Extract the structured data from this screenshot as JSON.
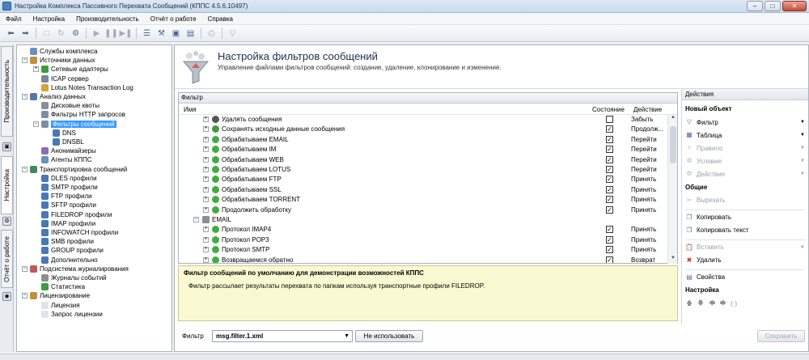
{
  "window": {
    "title": "Настройка Комплекса Пассивного Перехвата Сообщений (КППС 4.5.6.10497)",
    "minimize": "–",
    "maximize": "□",
    "close": "✕"
  },
  "menu": [
    "Файл",
    "Настройка",
    "Производительность",
    "Отчёт о работе",
    "Справка"
  ],
  "sidetabs": {
    "perf": "Производительность",
    "settings": "Настройка",
    "report": "Отчёт о работе"
  },
  "tree": [
    {
      "label": "Службы комплекса",
      "level": 0,
      "toggle": "",
      "icon": "#6b8fc0"
    },
    {
      "label": "Источники данных",
      "level": 0,
      "toggle": "−",
      "icon": "#c0913a"
    },
    {
      "label": "Сетевые адаптеры",
      "level": 1,
      "toggle": "+",
      "icon": "#3f9a3f"
    },
    {
      "label": "ICAP сервер",
      "level": 1,
      "toggle": "",
      "icon": "#7a8795"
    },
    {
      "label": "Lotus Notes Transaction Log",
      "level": 1,
      "toggle": "",
      "icon": "#d2a43a"
    },
    {
      "label": "Анализ данных",
      "level": 0,
      "toggle": "−",
      "icon": "#5577aa"
    },
    {
      "label": "Дисковые квоты",
      "level": 1,
      "toggle": "",
      "icon": "#8a8f96"
    },
    {
      "label": "Фильтры HTTP запросов",
      "level": 1,
      "toggle": "",
      "icon": "#7d8ea3"
    },
    {
      "label": "Фильтры сообщений",
      "level": 1,
      "toggle": "−",
      "icon": "#7d8ea3",
      "selected": true
    },
    {
      "label": "DNS",
      "level": 2,
      "toggle": "",
      "icon": "#4a78b5"
    },
    {
      "label": "DNSBL",
      "level": 2,
      "toggle": "",
      "icon": "#4a78b5"
    },
    {
      "label": "Анонимайзеры",
      "level": 1,
      "toggle": "",
      "icon": "#8a6fb0"
    },
    {
      "label": "Агенты КППС",
      "level": 1,
      "toggle": "",
      "icon": "#6b8fc0"
    },
    {
      "label": "Транспортировка сообщений",
      "level": 0,
      "toggle": "−",
      "icon": "#3f8a5a"
    },
    {
      "label": "DLES профили",
      "level": 1,
      "toggle": "",
      "icon": "#4a78b5"
    },
    {
      "label": "SMTP профили",
      "level": 1,
      "toggle": "",
      "icon": "#4a78b5"
    },
    {
      "label": "FTP профили",
      "level": 1,
      "toggle": "",
      "icon": "#4a78b5"
    },
    {
      "label": "SFTP профили",
      "level": 1,
      "toggle": "",
      "icon": "#4a78b5"
    },
    {
      "label": "FILEDROP профили",
      "level": 1,
      "toggle": "",
      "icon": "#4a78b5"
    },
    {
      "label": "IMAP профили",
      "level": 1,
      "toggle": "",
      "icon": "#4a78b5"
    },
    {
      "label": "INFOWATCH профили",
      "level": 1,
      "toggle": "",
      "icon": "#4a78b5"
    },
    {
      "label": "SMB профили",
      "level": 1,
      "toggle": "",
      "icon": "#4a78b5"
    },
    {
      "label": "GROUP профили",
      "level": 1,
      "toggle": "",
      "icon": "#4a78b5"
    },
    {
      "label": "Дополнительно",
      "level": 1,
      "toggle": "",
      "icon": "#4a78b5"
    },
    {
      "label": "Подсистема журналирования",
      "level": 0,
      "toggle": "−",
      "icon": "#c05a5a"
    },
    {
      "label": "Журналы событий",
      "level": 1,
      "toggle": "",
      "icon": "#8a8f96"
    },
    {
      "label": "Статистика",
      "level": 1,
      "toggle": "",
      "icon": "#3f9a3f"
    },
    {
      "label": "Лицензирование",
      "level": 0,
      "toggle": "−",
      "icon": "#c0913a"
    },
    {
      "label": "Лицензия",
      "level": 1,
      "toggle": "",
      "icon": "#dfe4ea"
    },
    {
      "label": "Запрос лицензии",
      "level": 1,
      "toggle": "",
      "icon": "#dfe4ea"
    }
  ],
  "header": {
    "title": "Настройка фильтров сообщений",
    "subtitle": "Управление файлами фильтров сообщений: создание, удаление, клонирование и изменение."
  },
  "filter_panel": {
    "title": "Фильтр",
    "col_name": "Имя",
    "col_state": "Состояние",
    "col_action": "Действие",
    "rows": [
      {
        "name": "Удалять сообщения",
        "level": 1,
        "icon": "#555555",
        "checked": false,
        "action": "Забыть"
      },
      {
        "name": "Сохранять исходные данные сообщения",
        "level": 1,
        "icon": "#3f9a3f",
        "checked": true,
        "action": "Продолж..."
      },
      {
        "name": "Обрабатываем EMAIL",
        "level": 1,
        "icon": "#3fae3f",
        "checked": true,
        "action": "Перейти"
      },
      {
        "name": "Обрабатываем IM",
        "level": 1,
        "icon": "#3fae3f",
        "checked": true,
        "action": "Перейти"
      },
      {
        "name": "Обрабатываем WEB",
        "level": 1,
        "icon": "#3fae3f",
        "checked": true,
        "action": "Перейти"
      },
      {
        "name": "Обрабатываем LOTUS",
        "level": 1,
        "icon": "#3fae3f",
        "checked": true,
        "action": "Перейти"
      },
      {
        "name": "Обрабатываем FTP",
        "level": 1,
        "icon": "#3fae3f",
        "checked": true,
        "action": "Принять"
      },
      {
        "name": "Обрабатываем SSL",
        "level": 1,
        "icon": "#3fae3f",
        "checked": true,
        "action": "Принять"
      },
      {
        "name": "Обрабатываем TORRENT",
        "level": 1,
        "icon": "#3fae3f",
        "checked": true,
        "action": "Принять"
      },
      {
        "name": "Продолжить обработку",
        "level": 1,
        "icon": "#3fae3f",
        "checked": true,
        "action": "Принять"
      },
      {
        "name": "EMAIL",
        "level": 0,
        "icon": "#8a8f96",
        "checked": null,
        "action": ""
      },
      {
        "name": "Протокол IMAP4",
        "level": 1,
        "icon": "#3fae3f",
        "checked": true,
        "action": "Принять"
      },
      {
        "name": "Протокол POP3",
        "level": 1,
        "icon": "#3fae3f",
        "checked": true,
        "action": "Принять"
      },
      {
        "name": "Протокол SMTP",
        "level": 1,
        "icon": "#3fae3f",
        "checked": true,
        "action": "Принять"
      },
      {
        "name": "Возвращаемся обратно",
        "level": 1,
        "icon": "#3fae3f",
        "checked": true,
        "action": "Возврат"
      }
    ]
  },
  "description": {
    "title": "Фильтр сообщений по умолчанию для демонстрации возможностей КППС",
    "text": "Фильтр рассылает результаты перехвата по папкам используя транспортные профили FILEDROP."
  },
  "bottom": {
    "filter_label": "Фильтр",
    "filter_value": "msg.filter.1.xml",
    "not_used_btn": "Не использовать",
    "save_btn": "Сохранить"
  },
  "actions": {
    "title": "Действия",
    "items": [
      {
        "type": "section",
        "label": "Новый объект"
      },
      {
        "type": "item",
        "label": "Фильтр",
        "icon": "▽",
        "arrow": true,
        "disabled": false
      },
      {
        "type": "item",
        "label": "Таблица",
        "icon": "▦",
        "arrow": true,
        "disabled": false
      },
      {
        "type": "item",
        "label": "Правило",
        "icon": "✧",
        "arrow": true,
        "disabled": true
      },
      {
        "type": "item",
        "label": "Условие",
        "icon": "⚙",
        "arrow": true,
        "disabled": true
      },
      {
        "type": "item",
        "label": "Действие",
        "icon": "⚙",
        "arrow": true,
        "disabled": true
      },
      {
        "type": "section",
        "label": "Общие"
      },
      {
        "type": "item",
        "label": "Вырезать",
        "icon": "✂",
        "arrow": false,
        "disabled": true
      },
      {
        "type": "sep"
      },
      {
        "type": "item",
        "label": "Копировать",
        "icon": "❐",
        "arrow": false,
        "disabled": false
      },
      {
        "type": "item",
        "label": "Копировать текст",
        "icon": "❐",
        "arrow": false,
        "disabled": false
      },
      {
        "type": "sep"
      },
      {
        "type": "item",
        "label": "Вставить",
        "icon": "📋",
        "arrow": true,
        "disabled": true
      },
      {
        "type": "item",
        "label": "Удалить",
        "icon": "✖",
        "arrow": false,
        "disabled": false
      },
      {
        "type": "sep"
      },
      {
        "type": "item",
        "label": "Свойства",
        "icon": "▤",
        "arrow": false,
        "disabled": false
      },
      {
        "type": "section",
        "label": "Настройка"
      },
      {
        "type": "moves",
        "label": "(·)"
      }
    ]
  }
}
